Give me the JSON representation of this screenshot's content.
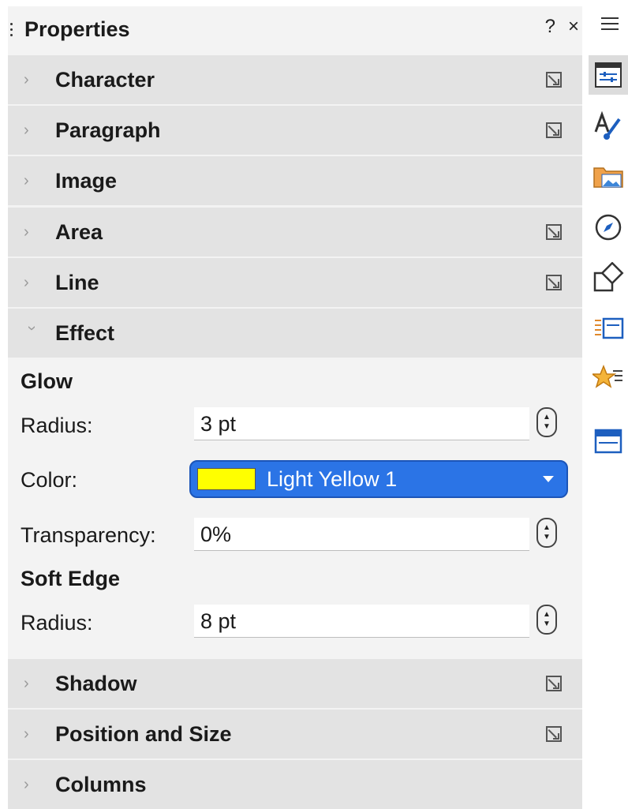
{
  "panel": {
    "title": "Properties",
    "help_label": "?",
    "close_label": "×"
  },
  "sections": [
    {
      "label": "Character",
      "expanded": false,
      "has_more": true
    },
    {
      "label": "Paragraph",
      "expanded": false,
      "has_more": true
    },
    {
      "label": "Image",
      "expanded": false,
      "has_more": false
    },
    {
      "label": "Area",
      "expanded": false,
      "has_more": true
    },
    {
      "label": "Line",
      "expanded": false,
      "has_more": true
    },
    {
      "label": "Effect",
      "expanded": true,
      "has_more": false
    },
    {
      "label": "Shadow",
      "expanded": false,
      "has_more": true
    },
    {
      "label": "Position and Size",
      "expanded": false,
      "has_more": true
    },
    {
      "label": "Columns",
      "expanded": false,
      "has_more": false
    }
  ],
  "effect": {
    "glow": {
      "title": "Glow",
      "radius_label": "Radius:",
      "radius_value": "3 pt",
      "color_label": "Color:",
      "color_value": "Light Yellow 1",
      "color_swatch": "#ffff00",
      "transparency_label": "Transparency:",
      "transparency_value": "0%"
    },
    "soft_edge": {
      "title": "Soft Edge",
      "radius_label": "Radius:",
      "radius_value": "8 pt"
    }
  },
  "sidebar_tabs": [
    {
      "icon": "properties-icon",
      "active": true
    },
    {
      "icon": "styles-icon",
      "active": false
    },
    {
      "icon": "gallery-icon",
      "active": false
    },
    {
      "icon": "navigator-icon",
      "active": false
    },
    {
      "icon": "shapes-icon",
      "active": false
    },
    {
      "icon": "slide-transition-icon",
      "active": false
    },
    {
      "icon": "animation-icon",
      "active": false
    },
    {
      "icon": "master-slides-icon",
      "active": false
    }
  ],
  "colors": {
    "accent": "#2b74e6",
    "panel_bg": "#f3f3f3",
    "section_bg": "#e3e3e3"
  }
}
